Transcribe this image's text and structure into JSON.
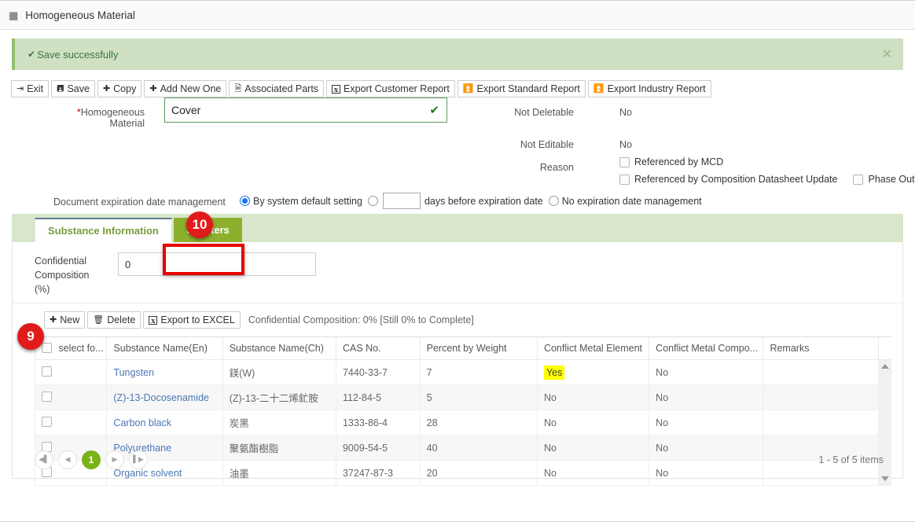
{
  "window": {
    "title": "Homogeneous Material",
    "grid_icon": "grid-icon"
  },
  "alert": {
    "check_icon": "check-icon",
    "message": "Save successfully",
    "close_icon": "close-icon"
  },
  "toolbar": {
    "buttons": [
      {
        "label": "Exit",
        "icon": "exit-icon",
        "glyph": "⇥"
      },
      {
        "label": "Save",
        "icon": "save-disk-icon",
        "glyph": "὚a"
      },
      {
        "label": "Copy",
        "icon": "plus-icon",
        "glyph": "+"
      },
      {
        "label": "Add New One",
        "icon": "plus-icon",
        "glyph": "+"
      },
      {
        "label": "Associated Parts",
        "icon": "document-icon",
        "glyph": "☰"
      },
      {
        "label": "Export Customer Report",
        "icon": "excel-icon",
        "glyph": "x"
      },
      {
        "label": "Export Standard Report",
        "icon": "download-icon",
        "glyph": "⤓"
      },
      {
        "label": "Export Industry Report",
        "icon": "download-icon",
        "glyph": "⤓"
      }
    ]
  },
  "form": {
    "homogeneous_material_label": "Homogeneous Material",
    "homogeneous_material_required_mark": "*",
    "homogeneous_material_value": "Cover",
    "homogeneous_material_placeholder": "",
    "valid_icon": "check-icon",
    "not_deletable_label": "Not Deletable",
    "not_deletable_value": "No",
    "not_editable_label": "Not Editable",
    "not_editable_value": "No",
    "reason_label": "Reason",
    "reason_options": [
      {
        "label": "Referenced by MCD",
        "checked": false
      },
      {
        "label": "Referenced by Composition Datasheet Update",
        "checked": false
      },
      {
        "label": "Phase Out",
        "checked": false
      }
    ],
    "doc_expiration_label": "Document expiration date management",
    "doc_expiration_options": [
      {
        "label": "By system default setting",
        "selected": true
      },
      {
        "label": "days before expiration date",
        "selected": false
      },
      {
        "label": "No expiration date management",
        "selected": false
      }
    ],
    "days_value": "",
    "days_placeholder": ""
  },
  "tabs": [
    {
      "label": "Substance Information",
      "active": true
    },
    {
      "label": "Smelters",
      "active": false
    }
  ],
  "panel": {
    "confidential_composition_label": "Confidential Composition (%)",
    "confidential_composition_label_lines": [
      "Confidential",
      "Composition",
      "(%)"
    ],
    "confidential_composition_value": "0",
    "grid_buttons": [
      {
        "label": "New",
        "icon": "plus-icon",
        "glyph": "+"
      },
      {
        "label": "Delete",
        "icon": "trash-icon",
        "glyph": "🗑"
      },
      {
        "label": "Export to EXCEL",
        "icon": "excel-icon",
        "glyph": "x"
      }
    ],
    "grid_note": "Confidential Composition: 0% [Still 0% to Complete]"
  },
  "table": {
    "select_all_label": "select fo...",
    "headers": [
      "Substance Name(En)",
      "Substance Name(Ch)",
      "CAS No.",
      "Percent by Weight",
      "Conflict Metal Element",
      "Conflict Metal Compo...",
      "Remarks"
    ],
    "rows": [
      {
        "checked": false,
        "name_en": "Tungsten",
        "name_ch": "鎂(W)",
        "cas": "7440-33-7",
        "percent": "7",
        "conflict_metal_element": "Yes",
        "conflict_metal_element_highlight": true,
        "conflict_metal_composition": "No",
        "remarks": ""
      },
      {
        "checked": false,
        "name_en": "(Z)-13-Docosenamide",
        "name_ch": "(Z)-13-二十二烯釯胺",
        "cas": "112-84-5",
        "percent": "5",
        "conflict_metal_element": "No",
        "conflict_metal_element_highlight": false,
        "conflict_metal_composition": "No",
        "remarks": ""
      },
      {
        "checked": false,
        "name_en": "Carbon black",
        "name_ch": "炭黑",
        "cas": "1333-86-4",
        "percent": "28",
        "conflict_metal_element": "No",
        "conflict_metal_element_highlight": false,
        "conflict_metal_composition": "No",
        "remarks": ""
      },
      {
        "checked": false,
        "name_en": "Polyurethane",
        "name_ch": "聚氨酯樹脂",
        "cas": "9009-54-5",
        "percent": "40",
        "conflict_metal_element": "No",
        "conflict_metal_element_highlight": false,
        "conflict_metal_composition": "No",
        "remarks": ""
      },
      {
        "checked": false,
        "name_en": "Organic solvent",
        "name_ch": "油墨",
        "cas": "37247-87-3",
        "percent": "20",
        "conflict_metal_element": "No",
        "conflict_metal_element_highlight": false,
        "conflict_metal_composition": "No",
        "remarks": ""
      }
    ]
  },
  "pager": {
    "first_icon": "first-page-icon",
    "prev_icon": "prev-page-icon",
    "current_page": "1",
    "next_icon": "next-page-icon",
    "last_icon": "last-page-icon",
    "items_text": "1 - 5 of 5 items"
  },
  "annotations": [
    {
      "badge": "10",
      "target": "smelters-tab"
    },
    {
      "badge": "9",
      "target": "new-button"
    }
  ],
  "colors": {
    "alert_bg": "#cfe0c3",
    "alert_text": "#3c763d",
    "tabstrip_bg": "#d8e7cb",
    "active_tab_text": "#7b9b3c",
    "inactive_tab_bg": "#8db02c",
    "annotation_red": "#e01b1b",
    "highlight_yellow": "#ffff00",
    "pager_current": "#7ab317",
    "link_blue": "#4a77b5"
  }
}
